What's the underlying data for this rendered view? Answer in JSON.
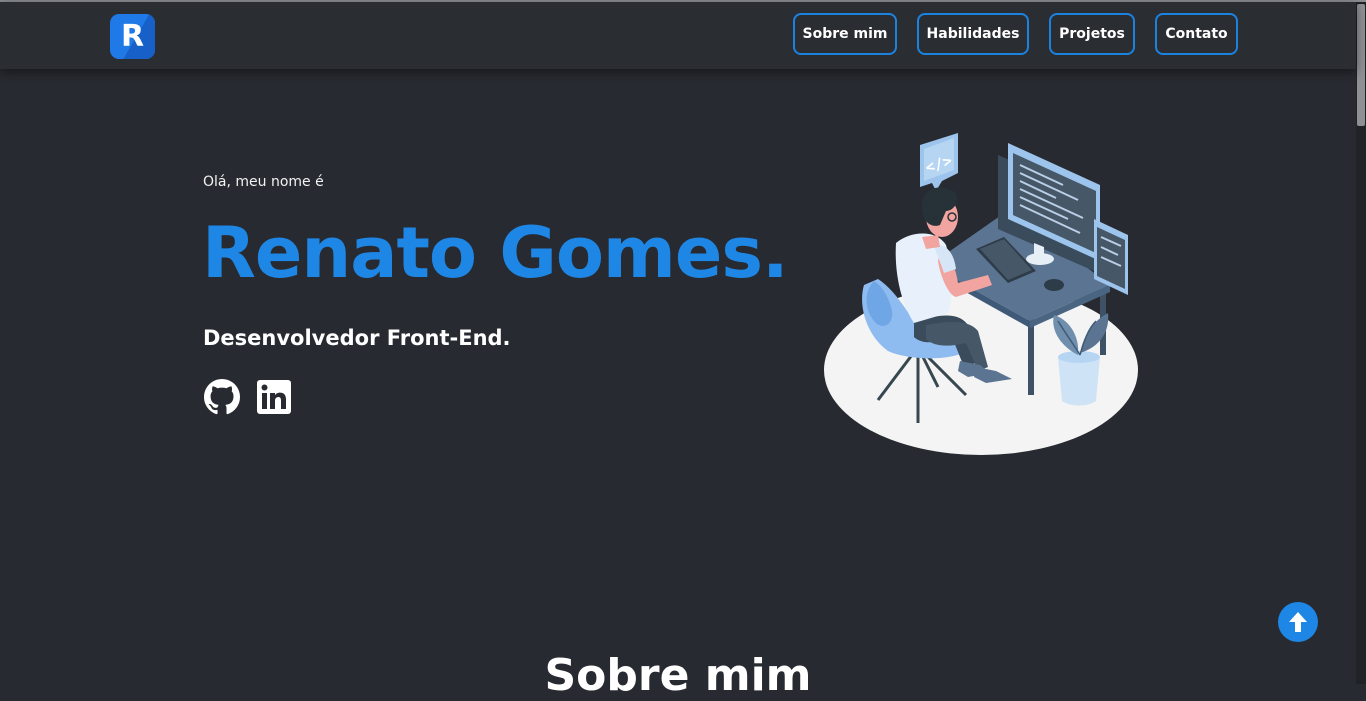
{
  "nav": {
    "logo_letter": "R",
    "links": [
      "Sobre mim",
      "Habilidades",
      "Projetos",
      "Contato"
    ]
  },
  "hero": {
    "greeting": "Olá, meu nome é",
    "name": "Renato Gomes.",
    "role": "Desenvolvedor Front-End."
  },
  "social": {
    "icons": [
      "github-icon",
      "linkedin-icon"
    ]
  },
  "illustration": {
    "code_bubble_text": "</>"
  },
  "sections": {
    "next_title": "Sobre mim"
  },
  "colors": {
    "background": "#272a30",
    "navbar": "#2a2d32",
    "accent": "#1e87e6",
    "text": "#ffffff"
  }
}
